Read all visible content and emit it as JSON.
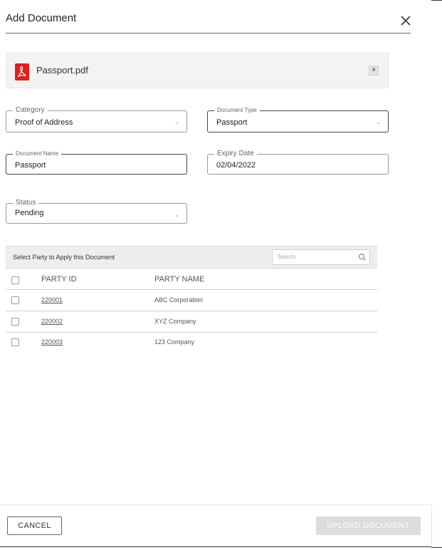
{
  "modal": {
    "title": "Add Document"
  },
  "file": {
    "name": "Passport.pdf",
    "remove_label": "×",
    "icon": "pdf-icon"
  },
  "fields": {
    "category": {
      "label": "Category",
      "value": "Proof of Address"
    },
    "document_type": {
      "label": "Document Type",
      "value": "Passport"
    },
    "document_name": {
      "label": "Document Name",
      "value": "Passport"
    },
    "expiry_date": {
      "label": "Expiry Date",
      "value": "02/04/2022"
    },
    "status": {
      "label": "Status",
      "value": "Pending"
    }
  },
  "party": {
    "header_label": "Select Party to Apply this Document",
    "search_placeholder": "Search",
    "columns": {
      "id": "PARTY ID",
      "name": "PARTY NAME"
    },
    "rows": [
      {
        "id": "220001",
        "name": "ABC Corporation"
      },
      {
        "id": "220002",
        "name": "XYZ Company"
      },
      {
        "id": "220003",
        "name": "123 Company"
      }
    ]
  },
  "footer": {
    "cancel_label": "CANCEL",
    "upload_label": "UPLOAD DOCUMENT"
  },
  "colors": {
    "pdf_red": "#e0201b",
    "disabled_button": "#dcdcdc"
  }
}
